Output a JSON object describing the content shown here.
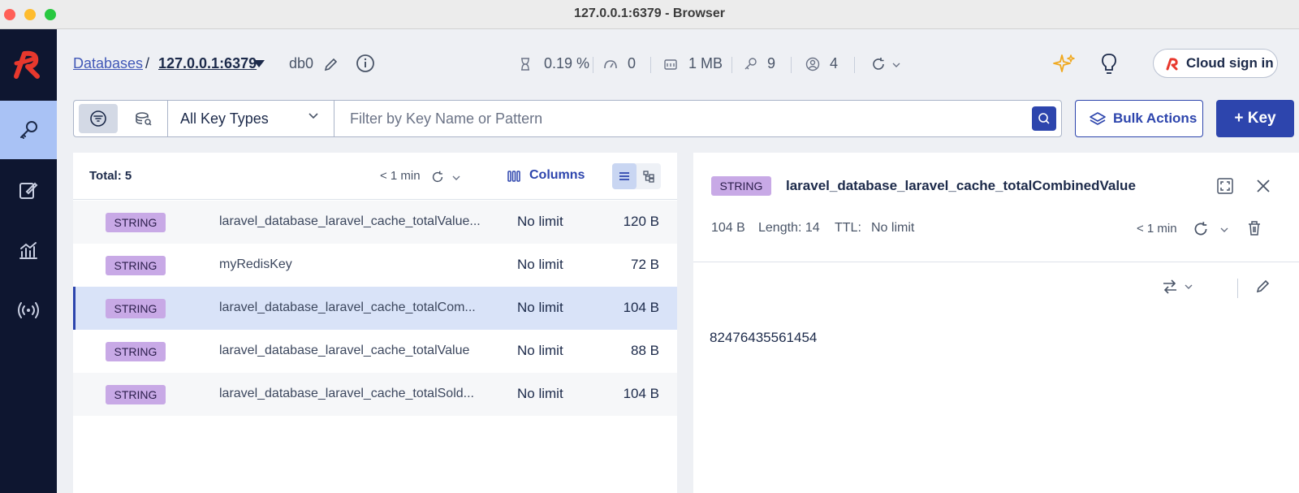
{
  "window": {
    "title": "127.0.0.1:6379 - Browser"
  },
  "breadcrumb": {
    "databases": "Databases",
    "separator": "/",
    "host": "127.0.0.1:6379",
    "db": "db0"
  },
  "stats": {
    "cpu": "0.19 %",
    "ops": "0",
    "memory": "1 MB",
    "keys": "9",
    "clients": "4"
  },
  "header": {
    "cloud_sign_in": "Cloud sign in"
  },
  "filter": {
    "key_type": "All Key Types",
    "search_placeholder": "Filter by Key Name or Pattern",
    "bulk_actions": "Bulk Actions",
    "add_key": "+ Key"
  },
  "list": {
    "total": "Total: 5",
    "refresh_age": "< 1 min",
    "columns_label": "Columns",
    "rows": [
      {
        "type": "STRING",
        "name": "laravel_database_laravel_cache_totalValue...",
        "ttl": "No limit",
        "size": "120 B"
      },
      {
        "type": "STRING",
        "name": "myRedisKey",
        "ttl": "No limit",
        "size": "72 B"
      },
      {
        "type": "STRING",
        "name": "laravel_database_laravel_cache_totalCom...",
        "ttl": "No limit",
        "size": "104 B"
      },
      {
        "type": "STRING",
        "name": "laravel_database_laravel_cache_totalValue",
        "ttl": "No limit",
        "size": "88 B"
      },
      {
        "type": "STRING",
        "name": "laravel_database_laravel_cache_totalSold...",
        "ttl": "No limit",
        "size": "104 B"
      }
    ]
  },
  "detail": {
    "type": "STRING",
    "key": "laravel_database_laravel_cache_totalCombinedValue",
    "size": "104 B",
    "length": "Length: 14",
    "ttl_label": "TTL:",
    "ttl_value": "No limit",
    "refresh_age": "< 1 min",
    "value": "82476435561454"
  },
  "colors": {
    "sidebar": "#0e1630",
    "accent": "#2d45ad",
    "badge": "#c8a9e6",
    "selected_row": "#d9e3f8"
  }
}
